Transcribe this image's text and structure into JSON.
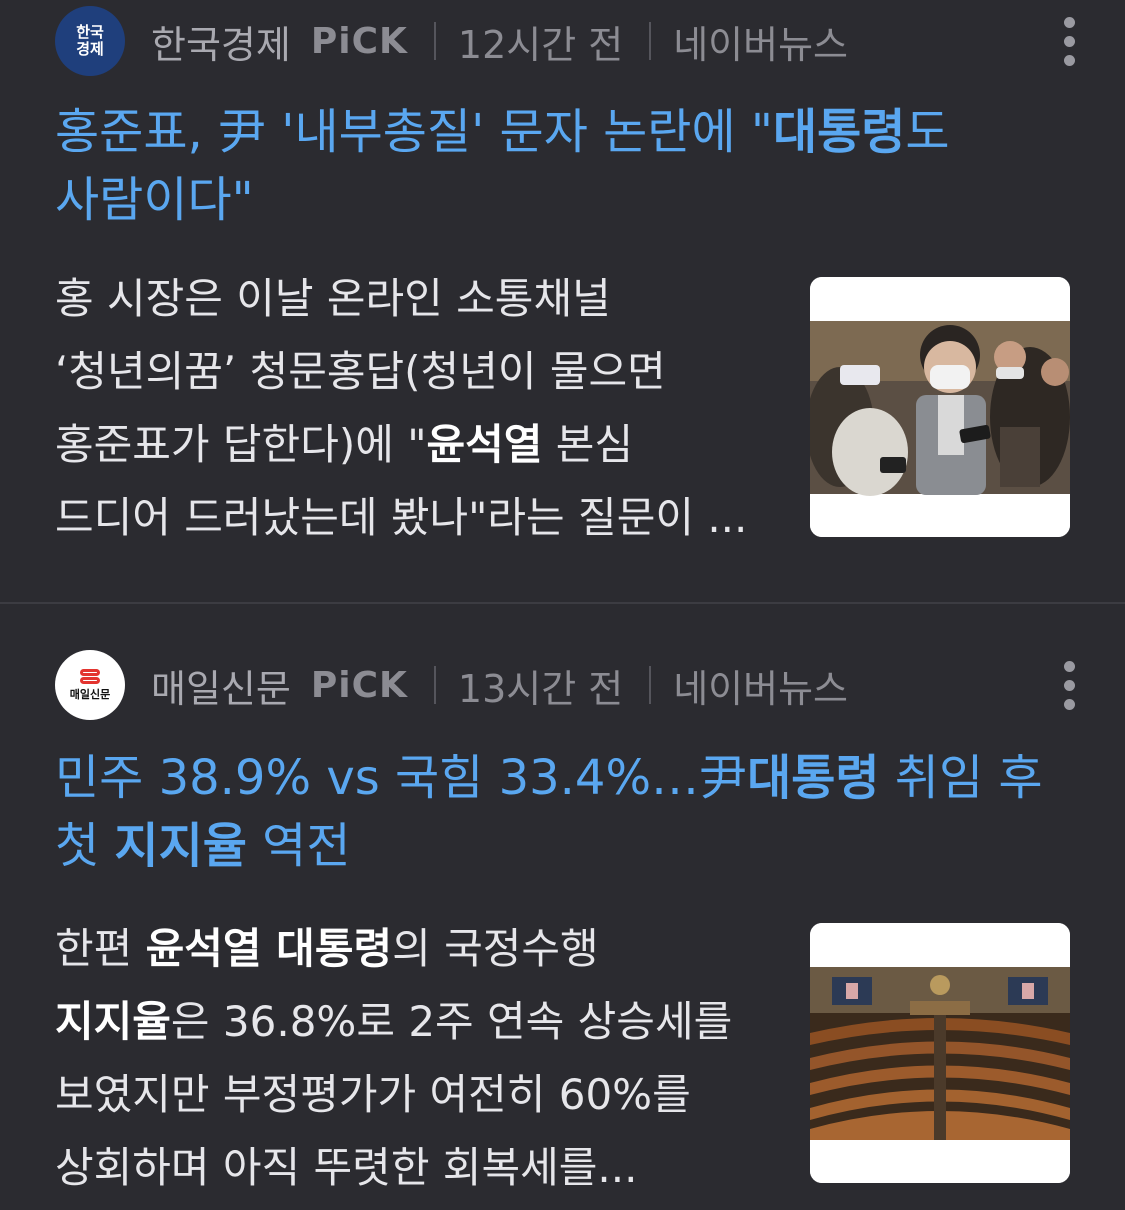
{
  "articles": [
    {
      "press": "한국경제",
      "logo_text": [
        "한국",
        "경제"
      ],
      "pick": "PiCK",
      "time": "12시간 전",
      "source": "네이버뉴스",
      "headline_parts": [
        "홍준표, 尹 '내부총질' 문자 논란에 \"",
        "대통령",
        "도 사람이다\""
      ],
      "summary_parts": [
        "홍 시장은 이날 온라인 소통채널 ‘청년의꿈’ 청문홍답(청년이 물으면 홍준표가 답한다)에 \"",
        "윤석열",
        " 본심 드디어 드러났는데 봤나\"라는 질문이 ..."
      ],
      "thumbnail": "press-crowd-photo"
    },
    {
      "press": "매일신문",
      "logo_text": [
        "매일신문"
      ],
      "pick": "PiCK",
      "time": "13시간 전",
      "source": "네이버뉴스",
      "headline_parts": [
        "민주 38.9% vs 국힘 33.4%…尹",
        "대통령",
        " 취임 후 첫 ",
        "지지율",
        " 역전"
      ],
      "summary_parts": [
        "한편 ",
        "윤석열 대통령",
        "의 국정수행 ",
        "지지율",
        "은 36.8%로 2주 연속 상승세를 보였지만 부정평가가 여전히 60%를 상회하며 아직 뚜렷한 회복세를..."
      ],
      "thumbnail": "national-assembly-photo"
    }
  ],
  "colors": {
    "background": "#2b2b30",
    "headline": "#5aa7f0",
    "meta": "#8c8c93",
    "summary": "#e6e6ea"
  },
  "icons": {
    "more": "more-vertical-icon"
  }
}
